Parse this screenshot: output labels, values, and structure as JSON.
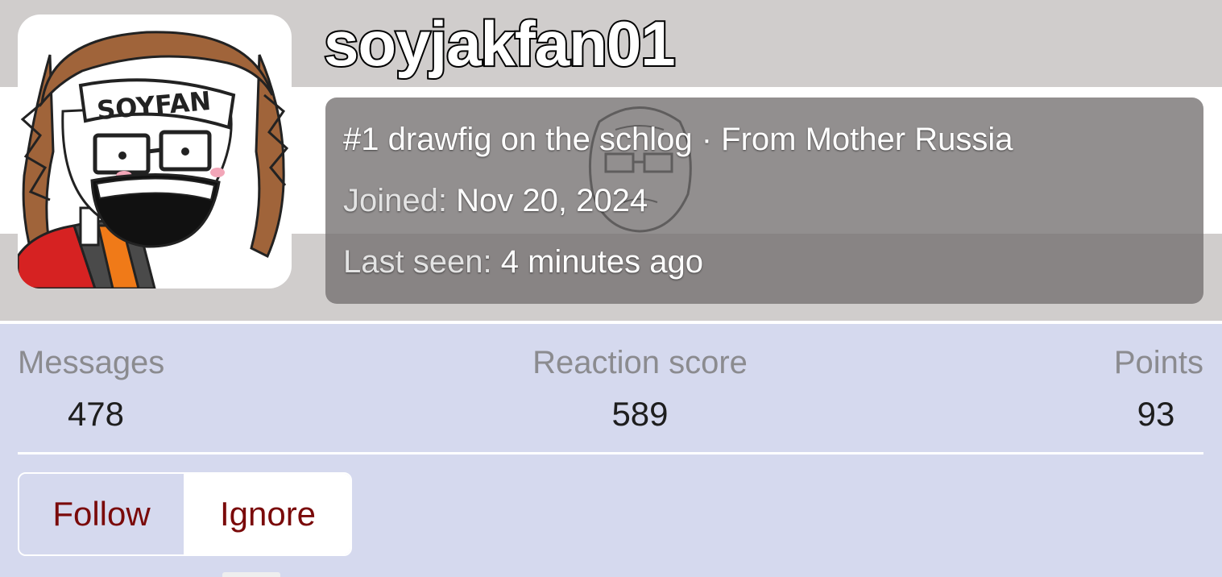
{
  "profile": {
    "username": "soyjakfan01",
    "avatar_text": "SOYFAN",
    "title_line": {
      "title": "#1 drawfig on the schlog",
      "separator": " · ",
      "location": "From Mother Russia"
    },
    "joined": {
      "label": "Joined:",
      "value": "Nov 20, 2024"
    },
    "last_seen": {
      "label": "Last seen:",
      "value": "4 minutes ago"
    }
  },
  "stats": {
    "messages": {
      "label": "Messages",
      "value": "478"
    },
    "reaction": {
      "label": "Reaction score",
      "value": "589"
    },
    "points": {
      "label": "Points",
      "value": "93"
    }
  },
  "actions": {
    "follow_label": "Follow",
    "ignore_label": "Ignore"
  },
  "colors": {
    "banner_gray": "#d0cdcc",
    "card_overlay": "#737070",
    "stats_background": "#d5d9ee",
    "button_text": "#7a0a0a"
  },
  "icons": {
    "avatar": "soyjak-character-avatar",
    "card_watermark": "wojak-face-watermark"
  }
}
